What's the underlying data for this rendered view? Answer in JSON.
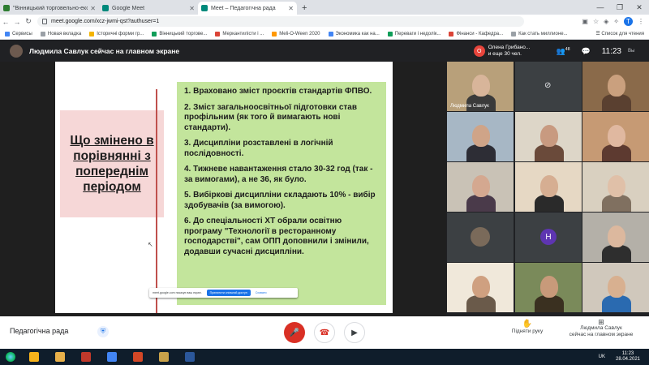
{
  "browser": {
    "tabs": [
      {
        "title": "\"Вінницький торговельно-економ...",
        "fav_color": "#2e7d32",
        "active": false
      },
      {
        "title": "Google Meet",
        "fav_color": "#00897b",
        "active": false
      },
      {
        "title": "Meet – Педагогічна рада",
        "fav_color": "#00897b",
        "active": true
      }
    ],
    "new_tab": "+",
    "url": "meet.google.com/xcz-jwmi-qst?authuser=1",
    "bookmarks": [
      {
        "label": "Сервисы",
        "color": "#4285f4"
      },
      {
        "label": "Новая вкладка",
        "color": "#9aa0a6"
      },
      {
        "label": "Історичні форми гр...",
        "color": "#f4b400"
      },
      {
        "label": "Вінницький торгове...",
        "color": "#0f9d58"
      },
      {
        "label": "Меркантилісти і ...",
        "color": "#db4437"
      },
      {
        "label": "Meli-O-Ween 2020",
        "color": "#ff9800"
      },
      {
        "label": "Экономика как на...",
        "color": "#4285f4"
      },
      {
        "label": "Переваги і недолік...",
        "color": "#0f9d58"
      },
      {
        "label": "Фінанси - Кафедра...",
        "color": "#db4437"
      },
      {
        "label": "Как стать миллионе...",
        "color": "#9aa0a6"
      }
    ],
    "reading_list": "Список для чтения",
    "profile_initial": "T"
  },
  "meet": {
    "presenter_text": "Людмила Савлук сейчас на главном экране",
    "joined": {
      "initial": "О",
      "line1": "Олена Грибано...",
      "line2": "и еще 30 чел."
    },
    "participants_count": "48",
    "time": "11:23",
    "me_label": "Вы",
    "meeting_name": "Педагогічна рада",
    "raise_hand": "Підняти руку",
    "present_line1": "Людмила Савлук",
    "present_line2": "сейчас на главном экране",
    "share_bar": {
      "text": "meet.google.com показує ваш екран.",
      "stop": "Припинити спільний доступ",
      "hide": "Сховати"
    }
  },
  "slide": {
    "left_title": "Що змінено в порівнянні з попереднім періодом",
    "items": [
      "1. Враховано зміст проєктів стандартів ФПВО.",
      "2. Зміст загальноосвітньої підготовки став профільним (як того й вимагають нові стандарти).",
      "3. Дисципліни розставлені в логічній послідовності.",
      "4. Тижневе навантаження стало 30-32 год (так - за вимогами), а не 36, як було.",
      "5. Вибіркові дисципліни складають 10% - вибір здобувачів (за вимогою).",
      "6. До спеціальності ХТ обрали освітню програму \"Технології в ресторанному господарстві\", сам ОПП доповнили і змінили, додавши сучасні дисципліни."
    ]
  },
  "tiles": [
    {
      "label": "Людмила Савлук",
      "bg": "#b8a07a",
      "skin": "#d8b59a",
      "shirt": "#3a3a3a",
      "kind": "person"
    },
    {
      "label": "",
      "bg": "#3c4043",
      "kind": "camoff"
    },
    {
      "label": "",
      "bg": "#8a6a4a",
      "skin": "#caa07e",
      "shirt": "#5a4030",
      "kind": "person"
    },
    {
      "label": "",
      "bg": "#a7b7c5",
      "skin": "#cfa488",
      "shirt": "#2d2d35",
      "kind": "person"
    },
    {
      "label": "",
      "bg": "#ddd6c8",
      "skin": "#c89a80",
      "shirt": "#6a4a3a",
      "kind": "person"
    },
    {
      "label": "",
      "bg": "#c69a74",
      "skin": "#e0b8a0",
      "shirt": "#5d3a30",
      "kind": "person"
    },
    {
      "label": "",
      "bg": "#c9c2b6",
      "skin": "#d4a890",
      "shirt": "#4a3a4a",
      "kind": "person"
    },
    {
      "label": "",
      "bg": "#e6d8c4",
      "skin": "#d6ae92",
      "shirt": "#2a2a2a",
      "kind": "person"
    },
    {
      "label": "",
      "bg": "#d9d0c0",
      "skin": "#e0c0a8",
      "shirt": "#807060",
      "kind": "person"
    },
    {
      "label": "",
      "bg": "#3c4043",
      "skin": "#d0b090",
      "shirt": "#3a3a3a",
      "kind": "avatar",
      "avatar_color": "#7a6a5a"
    },
    {
      "label": "",
      "bg": "#3c4043",
      "kind": "initial",
      "initial": "Н",
      "initial_color": "#5e35b1"
    },
    {
      "label": "",
      "bg": "#b4b0a8",
      "skin": "#dcb89e",
      "shirt": "#2e2e2e",
      "kind": "person"
    },
    {
      "label": "",
      "bg": "#f0e8da",
      "skin": "#cfa080",
      "shirt": "#6a5a4a",
      "kind": "person"
    },
    {
      "label": "",
      "bg": "#7a8a5a",
      "skin": "#c89a7a",
      "shirt": "#3a3020",
      "kind": "person"
    },
    {
      "label": "",
      "bg": "#d0c8bc",
      "skin": "#d8b090",
      "shirt": "#2a6ab0",
      "kind": "person"
    }
  ],
  "taskbar": {
    "apps": [
      {
        "name": "ie-icon",
        "color": "#f6b21b"
      },
      {
        "name": "explorer-icon",
        "color": "#e8b04a"
      },
      {
        "name": "paint-icon",
        "color": "#c0392b"
      },
      {
        "name": "chrome-icon",
        "color": "#4285f4"
      },
      {
        "name": "powerpoint-icon",
        "color": "#d24726"
      },
      {
        "name": "folder-icon",
        "color": "#c9a24a"
      },
      {
        "name": "word-icon",
        "color": "#2b579a"
      }
    ],
    "lang": "UK",
    "time": "11:23",
    "date": "28.04.2021"
  }
}
